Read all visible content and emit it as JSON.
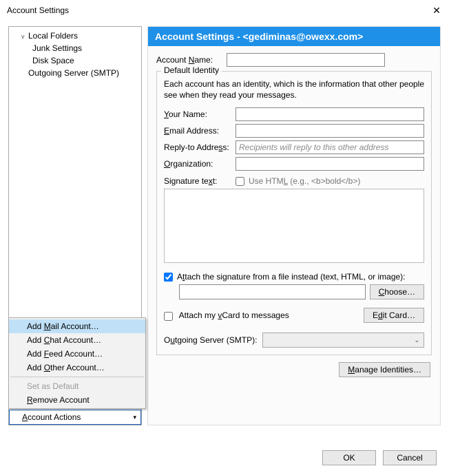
{
  "window": {
    "title": "Account Settings"
  },
  "tree": {
    "root": "Local Folders",
    "children": [
      "Junk Settings",
      "Disk Space"
    ],
    "smtp": "Outgoing Server (SMTP)"
  },
  "accountActions": {
    "label": "Account Actions",
    "menu": {
      "addMail": "Add Mail Account…",
      "addChat": "Add Chat Account…",
      "addFeed": "Add Feed Account…",
      "addOther": "Add Other Account…",
      "setDefault": "Set as Default",
      "remove": "Remove Account"
    }
  },
  "banner": "Account Settings - <gediminas@owexx.com>",
  "form": {
    "accountNameLabel": "Account Name:",
    "accountNameAccess": "N",
    "accountNameValue": "",
    "identityLegend": "Default Identity",
    "identityDesc": "Each account has an identity, which is the information that other people see when they read your messages.",
    "yourName": {
      "label": "Your Name:",
      "access": "Y",
      "value": ""
    },
    "email": {
      "label": "Email Address:",
      "access": "E",
      "value": ""
    },
    "replyTo": {
      "label": "Reply-to Address:",
      "access": "s",
      "value": "",
      "placeholder": "Recipients will reply to this other address"
    },
    "org": {
      "label": "Organization:",
      "access": "O",
      "value": ""
    },
    "sigLabel": "Signature text:",
    "sigAccess": "x",
    "useHtml": {
      "checked": false,
      "label": "Use HTML (e.g., <b>bold</b>)",
      "access": "L"
    },
    "sigText": "",
    "attachFile": {
      "checked": true,
      "label": "Attach the signature from a file instead (text, HTML, or image):",
      "access": "t"
    },
    "filePath": "",
    "chooseLabel": "Choose…",
    "chooseAccess": "C",
    "vcard": {
      "checked": false,
      "label": "Attach my vCard to messages",
      "access": "v"
    },
    "editCardLabel": "Edit Card…",
    "editCardAccess": "d",
    "smtpLabel": "Outgoing Server (SMTP):",
    "smtpAccess": "u",
    "manageLabel": "Manage Identities…",
    "manageAccess": "M"
  },
  "footer": {
    "ok": "OK",
    "cancel": "Cancel"
  }
}
